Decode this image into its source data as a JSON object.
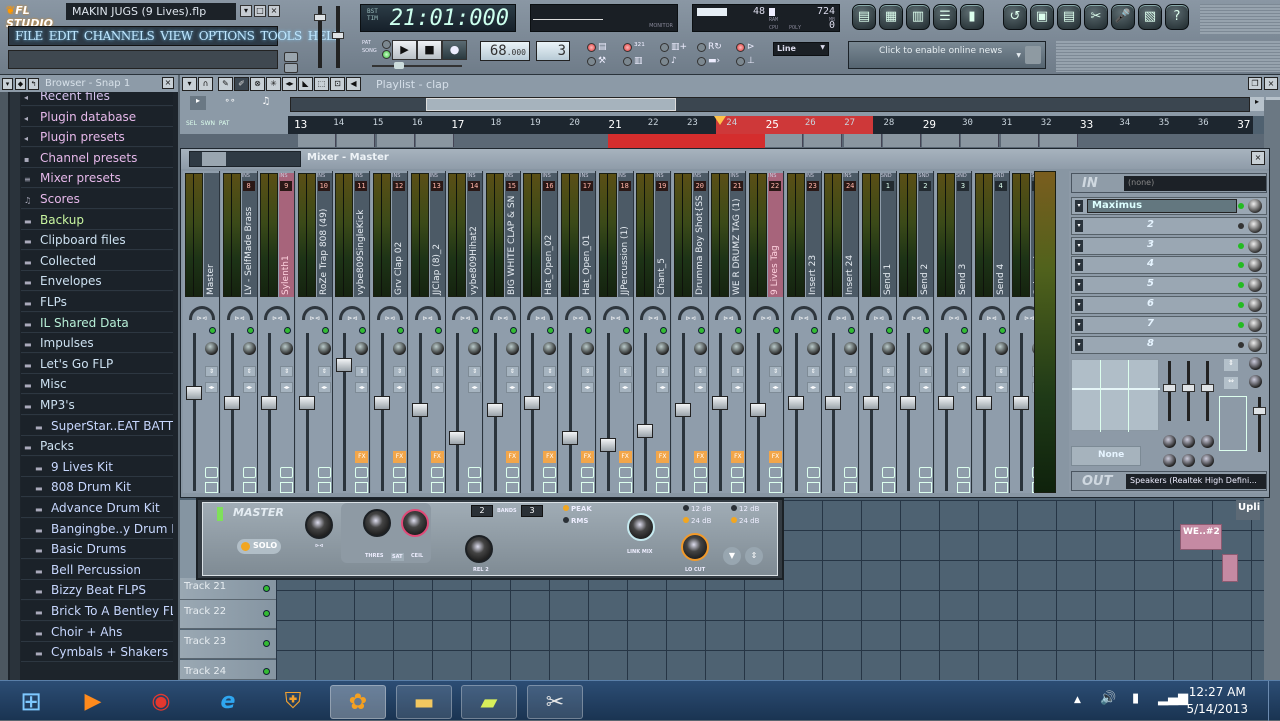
{
  "app": {
    "logo": "FL STUDIO",
    "title": "MAKIN JUGS (9 Lives).flp",
    "menu": [
      "FILE",
      "EDIT",
      "CHANNELS",
      "VIEW",
      "OPTIONS",
      "TOOLS",
      "HELP"
    ],
    "window_buttons": {
      "minimize": "▾",
      "maximize": "□",
      "close": "×"
    }
  },
  "transport": {
    "song_position": "21:01:000",
    "song_position_labels": [
      "BST",
      "TIM"
    ],
    "monitor_label": "MONITOR",
    "cpu_value": "48",
    "ram_value": "724",
    "poly_value": "0",
    "cpu_labels": {
      "ram": "RAM",
      "mb": "MB",
      "cpu": "CPU",
      "poly": "POLY"
    },
    "mode_labels": {
      "pat": "PAT",
      "song": "SONG"
    },
    "mode_selected": "SONG",
    "play": "▶",
    "stop": "■",
    "record": "●",
    "tempo": "68",
    "tempo_decimal": ".000",
    "pattern": "3",
    "snap_mode": "Line",
    "online_news": "Click to enable online news"
  },
  "toolbar_icons": [
    {
      "name": "playlist-icon",
      "glyph": "▤"
    },
    {
      "name": "step-sequencer-icon",
      "glyph": "▦"
    },
    {
      "name": "piano-roll-icon",
      "glyph": "▥"
    },
    {
      "name": "browser-icon",
      "glyph": "☰"
    },
    {
      "name": "mixer-icon",
      "glyph": "▮"
    },
    {
      "name": "undo-icon",
      "glyph": "↺"
    },
    {
      "name": "save-icon",
      "glyph": "▣"
    },
    {
      "name": "save-as-icon",
      "glyph": "▤"
    },
    {
      "name": "cut-icon",
      "glyph": "✂"
    },
    {
      "name": "record-mic-icon",
      "glyph": "🎤"
    },
    {
      "name": "notes-icon",
      "glyph": "▧"
    },
    {
      "name": "help-icon",
      "glyph": "?"
    }
  ],
  "browser": {
    "title": "Browser - Snap 1",
    "items": [
      {
        "label": "Recent files",
        "color": "#d6c2ee",
        "icon": "◂",
        "sub": false
      },
      {
        "label": "Plugin database",
        "color": "#e6b8ea",
        "icon": "◂",
        "sub": false
      },
      {
        "label": "Plugin presets",
        "color": "#e6b8ea",
        "icon": "◂",
        "sub": false
      },
      {
        "label": "Channel presets",
        "color": "#e6b8ea",
        "icon": "▪",
        "sub": false
      },
      {
        "label": "Mixer presets",
        "color": "#e6b8ea",
        "icon": "≡",
        "sub": false
      },
      {
        "label": "Scores",
        "color": "#e6b8ea",
        "icon": "♫",
        "sub": false
      },
      {
        "label": "Backup",
        "color": "#c8f5a0",
        "icon": "▬",
        "sub": false
      },
      {
        "label": "Clipboard files",
        "color": "#cce0f0",
        "icon": "▬",
        "sub": false
      },
      {
        "label": "Collected",
        "color": "#cce0f0",
        "icon": "▬",
        "sub": false
      },
      {
        "label": "Envelopes",
        "color": "#cce0f0",
        "icon": "▬",
        "sub": false
      },
      {
        "label": "FLPs",
        "color": "#cce0f0",
        "icon": "▬",
        "sub": false
      },
      {
        "label": "IL Shared Data",
        "color": "#b8f0d8",
        "icon": "▬",
        "sub": false
      },
      {
        "label": "Impulses",
        "color": "#cce0f0",
        "icon": "▬",
        "sub": false
      },
      {
        "label": "Let's Go FLP",
        "color": "#cce0f0",
        "icon": "▬",
        "sub": false
      },
      {
        "label": "Misc",
        "color": "#cce0f0",
        "icon": "▬",
        "sub": false
      },
      {
        "label": "MP3's",
        "color": "#cce0f0",
        "icon": "▬",
        "sub": false
      },
      {
        "label": "SuperStar..EAT BATTLE",
        "color": "#c8d8ff",
        "icon": "▬",
        "sub": true
      },
      {
        "label": "Packs",
        "color": "#cce0f0",
        "icon": "▬",
        "sub": false
      },
      {
        "label": "9 Lives Kit",
        "color": "#c8d8ff",
        "icon": "▬",
        "sub": true
      },
      {
        "label": "808 Drum Kit",
        "color": "#c8d8ff",
        "icon": "▬",
        "sub": true
      },
      {
        "label": "Advance Drum Kit",
        "color": "#c8d8ff",
        "icon": "▬",
        "sub": true
      },
      {
        "label": "Bangingbe..y Drum Kit",
        "color": "#c8d8ff",
        "icon": "▬",
        "sub": true
      },
      {
        "label": "Basic Drums",
        "color": "#c8d8ff",
        "icon": "▬",
        "sub": true
      },
      {
        "label": "Bell Percussion",
        "color": "#c8d8ff",
        "icon": "▬",
        "sub": true
      },
      {
        "label": "Bizzy Beat FLPS",
        "color": "#c8d8ff",
        "icon": "▬",
        "sub": true
      },
      {
        "label": "Brick To A Bentley FLP",
        "color": "#c8d8ff",
        "icon": "▬",
        "sub": true
      },
      {
        "label": "Choir + Ahs",
        "color": "#c8d8ff",
        "icon": "▬",
        "sub": true
      },
      {
        "label": "Cymbals + Shakers",
        "color": "#c8d8ff",
        "icon": "▬",
        "sub": true
      }
    ]
  },
  "playlist": {
    "title": "Playlist - clap",
    "ruler": [
      "13",
      "14",
      "15",
      "16",
      "17",
      "18",
      "19",
      "20",
      "21",
      "22",
      "23",
      "24",
      "25",
      "26",
      "27",
      "28",
      "29",
      "30",
      "31",
      "32",
      "33",
      "34",
      "35",
      "36",
      "37"
    ],
    "loop_start": "21",
    "loop_end": "25",
    "mode_labels": [
      "SEL",
      "SWN",
      "PAT"
    ],
    "tracks": [
      "Track 21",
      "Track 22",
      "Track 23",
      "Track 24"
    ],
    "clips": [
      {
        "label": "WE..#2"
      },
      {
        "label": ""
      }
    ],
    "top_right_clip": "Upli"
  },
  "mixer": {
    "title": "Mixer - Master",
    "strips": [
      {
        "name": "Master",
        "num": "",
        "type": "master",
        "fader": 0.62,
        "pink": false
      },
      {
        "name": "LV - SelfMade Brass",
        "num": "8",
        "type": "ins",
        "fader": 0.55,
        "pink": false,
        "fx": false
      },
      {
        "name": "Sylenth1",
        "num": "9",
        "type": "ins",
        "fader": 0.55,
        "pink": true,
        "fx": false
      },
      {
        "name": "RoZe Trap 808 (49)",
        "num": "10",
        "type": "ins",
        "fader": 0.55,
        "pink": false,
        "fx": false
      },
      {
        "name": "vybe809SingleKick",
        "num": "11",
        "type": "ins",
        "fader": 0.82,
        "pink": false,
        "fx": true
      },
      {
        "name": "Grv Clap 02",
        "num": "12",
        "type": "ins",
        "fader": 0.55,
        "pink": false,
        "fx": true
      },
      {
        "name": "JJClap (8)_2",
        "num": "13",
        "type": "ins",
        "fader": 0.5,
        "pink": false,
        "fx": true
      },
      {
        "name": "vybe809Hihat2",
        "num": "14",
        "type": "ins",
        "fader": 0.3,
        "pink": false,
        "fx": false
      },
      {
        "name": "BIG WHITE CLAP & SN",
        "num": "15",
        "type": "ins",
        "fader": 0.5,
        "pink": false,
        "fx": true
      },
      {
        "name": "Hat_Open_02",
        "num": "16",
        "type": "ins",
        "fader": 0.55,
        "pink": false,
        "fx": true
      },
      {
        "name": "Hat_Open_01",
        "num": "17",
        "type": "ins",
        "fader": 0.3,
        "pink": false,
        "fx": true
      },
      {
        "name": "JJPercussion (1)",
        "num": "18",
        "type": "ins",
        "fader": 0.25,
        "pink": false,
        "fx": true
      },
      {
        "name": "Chant_5",
        "num": "19",
        "type": "ins",
        "fader": 0.35,
        "pink": false,
        "fx": true
      },
      {
        "name": "Drumma Boy Shot{SS",
        "num": "20",
        "type": "ins",
        "fader": 0.5,
        "pink": false,
        "fx": true
      },
      {
        "name": "WE R DRUMZ TAG (1)",
        "num": "21",
        "type": "ins",
        "fader": 0.55,
        "pink": false,
        "fx": true
      },
      {
        "name": "9 Lives Tag",
        "num": "22",
        "type": "ins",
        "fader": 0.5,
        "pink": true,
        "fx": true
      },
      {
        "name": "Insert 23",
        "num": "23",
        "type": "ins",
        "fader": 0.55,
        "pink": false,
        "fx": false
      },
      {
        "name": "Insert 24",
        "num": "24",
        "type": "ins",
        "fader": 0.55,
        "pink": false,
        "fx": false
      },
      {
        "name": "Send 1",
        "num": "1",
        "type": "snd",
        "fader": 0.55,
        "pink": false,
        "fx": false
      },
      {
        "name": "Send 2",
        "num": "2",
        "type": "snd",
        "fader": 0.55,
        "pink": false,
        "fx": false
      },
      {
        "name": "Send 3",
        "num": "3",
        "type": "snd",
        "fader": 0.55,
        "pink": false,
        "fx": false
      },
      {
        "name": "Send 4",
        "num": "4",
        "type": "snd",
        "fader": 0.55,
        "pink": false,
        "fx": false
      },
      {
        "name": "Selected",
        "num": "S",
        "type": "snd",
        "fader": 0.55,
        "pink": false,
        "fx": false
      }
    ],
    "fx": {
      "in_label": "IN",
      "in_value": "(none)",
      "slots": [
        {
          "label": "Maximus",
          "active": true,
          "enabled": true
        },
        {
          "label": "2",
          "active": false,
          "enabled": false
        },
        {
          "label": "3",
          "active": false,
          "enabled": true
        },
        {
          "label": "4",
          "active": false,
          "enabled": true
        },
        {
          "label": "5",
          "active": false,
          "enabled": true
        },
        {
          "label": "6",
          "active": false,
          "enabled": true
        },
        {
          "label": "7",
          "active": false,
          "enabled": true
        },
        {
          "label": "8",
          "active": false,
          "enabled": false
        }
      ],
      "eq_preset": "None",
      "out_label": "OUT",
      "out_value": "Speakers (Realtek High Defini..."
    }
  },
  "maximus": {
    "band": "MASTER",
    "solo": "SOLO",
    "labels": {
      "thres": "THRES",
      "sat": "SAT",
      "ceil": "CEIL",
      "rel2": "REL 2",
      "link_mix": "LINK MIX",
      "lo_cut": "LO CUT",
      "bands": "BANDS"
    },
    "band_box_1": "2",
    "band_box_2": "3",
    "peak": "PEAK",
    "rms": "RMS",
    "db_a": [
      "12 dB",
      "24 dB"
    ],
    "db_b": [
      "12 dB",
      "24 dB"
    ]
  },
  "taskbar": {
    "time": "12:27 AM",
    "date": "5/14/2013",
    "apps": [
      {
        "name": "start-button",
        "glyph": "⊞"
      },
      {
        "name": "media-player-icon",
        "glyph": "▶"
      },
      {
        "name": "chrome-icon",
        "glyph": "◉"
      },
      {
        "name": "internet-explorer-icon",
        "glyph": "e"
      },
      {
        "name": "security-icon",
        "glyph": "⛨"
      },
      {
        "name": "fl-studio-icon",
        "glyph": "✿"
      },
      {
        "name": "file-explorer-icon",
        "glyph": "▬"
      },
      {
        "name": "sticky-notes-icon",
        "glyph": "▰"
      },
      {
        "name": "snipping-tool-icon",
        "glyph": "✂"
      }
    ]
  }
}
